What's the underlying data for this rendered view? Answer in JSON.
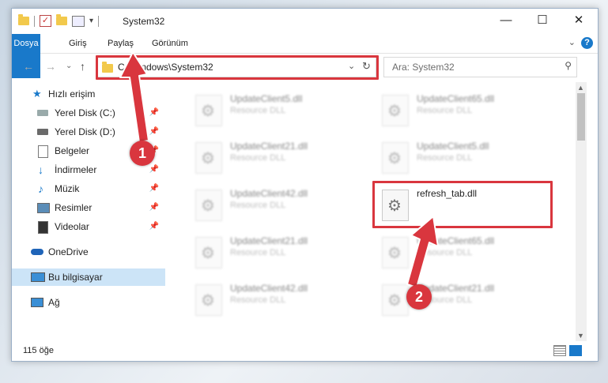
{
  "window": {
    "title": "System32",
    "minimize": "—",
    "maximize": "☐",
    "close": "✕"
  },
  "ribbon": {
    "tabs": [
      "Dosya",
      "Giriş",
      "Paylaş",
      "Görünüm"
    ],
    "help": "?"
  },
  "address": {
    "path": "C:\\Windows\\System32",
    "search_placeholder": "Ara: System32"
  },
  "nav": {
    "items": [
      {
        "label": "Hızlı erişim",
        "icon": "star-icon"
      },
      {
        "label": "Yerel Disk (C:)",
        "icon": "drive-icon",
        "pinned": true
      },
      {
        "label": "Yerel Disk (D:)",
        "icon": "drive-icon",
        "pinned": true
      },
      {
        "label": "Belgeler",
        "icon": "documents-icon",
        "pinned": true
      },
      {
        "label": "İndirmeler",
        "icon": "download-icon",
        "pinned": true
      },
      {
        "label": "Müzik",
        "icon": "music-icon",
        "pinned": true
      },
      {
        "label": "Resimler",
        "icon": "pictures-icon",
        "pinned": true
      },
      {
        "label": "Videolar",
        "icon": "videos-icon",
        "pinned": true
      },
      {
        "label": "OneDrive",
        "icon": "cloud-icon"
      },
      {
        "label": "Bu bilgisayar",
        "icon": "computer-icon",
        "selected": true
      },
      {
        "label": "Ağ",
        "icon": "network-icon"
      }
    ]
  },
  "files": [
    {
      "name": "UpdateClient5.dll",
      "desc": "Resource DLL"
    },
    {
      "name": "UpdateClient65.dll",
      "desc": "Resource DLL"
    },
    {
      "name": "UpdateClient21.dll",
      "desc": "Resource DLL"
    },
    {
      "name": "UpdateClient5.dll",
      "desc": "Resource DLL"
    },
    {
      "name": "UpdateClient42.dll",
      "desc": "Resource DLL"
    },
    {
      "name": "refresh_tab.dll",
      "desc": ""
    },
    {
      "name": "UpdateClient21.dll",
      "desc": "Resource DLL"
    },
    {
      "name": "UpdateClient65.dll",
      "desc": "Resource DLL"
    },
    {
      "name": "UpdateClient42.dll",
      "desc": "Resource DLL"
    },
    {
      "name": "UpdateClient21.dll",
      "desc": "Resource DLL"
    }
  ],
  "status": {
    "item_count": "115 öğe"
  },
  "annotations": {
    "badge1": "1",
    "badge2": "2",
    "color": "#d9363e"
  },
  "colors": {
    "accent": "#1979ca",
    "selection": "#cce4f7"
  }
}
